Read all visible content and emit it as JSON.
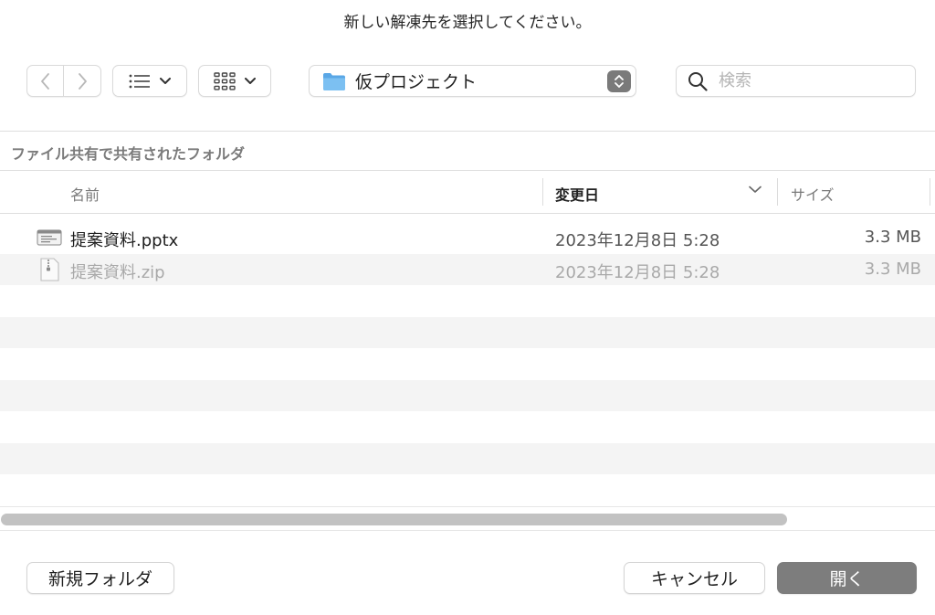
{
  "dialog": {
    "title": "新しい解凍先を選択してください。"
  },
  "toolbar": {
    "back_icon": "chevron-left-icon",
    "forward_icon": "chevron-right-icon",
    "list_view_icon": "list-icon",
    "grid_view_icon": "grid-icon",
    "location_label": "仮プロジェクト",
    "location_icon": "folder-icon",
    "search_placeholder": "検索"
  },
  "section": {
    "title": "ファイル共有で共有されたフォルダ"
  },
  "table": {
    "columns": {
      "name": "名前",
      "date": "変更日",
      "size": "サイズ"
    },
    "rows": [
      {
        "name": "提案資料.pptx",
        "date": "2023年12月8日 5:28",
        "size": "3.3 MB",
        "icon": "pptx-file-icon"
      },
      {
        "name": "提案資料.zip",
        "date": "2023年12月8日 5:28",
        "size": "3.3 MB",
        "icon": "zip-file-icon"
      }
    ]
  },
  "footer": {
    "new_folder": "新規フォルダ",
    "cancel": "キャンセル",
    "open": "開く"
  },
  "colors": {
    "accent_button": "#7d7d7d",
    "folder_blue": "#6cb4ee",
    "row_alt": "#f4f4f4"
  }
}
